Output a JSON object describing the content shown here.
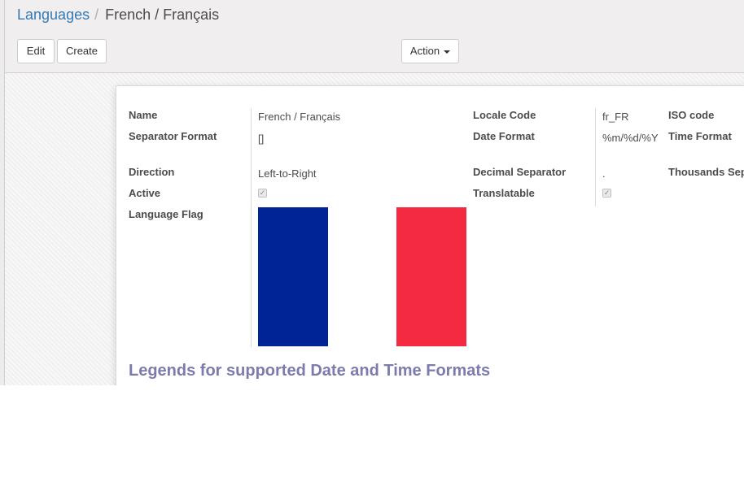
{
  "breadcrumb": {
    "parent": "Languages",
    "separator": "/",
    "current": "French / Français"
  },
  "buttons": {
    "edit": "Edit",
    "create": "Create",
    "action": "Action"
  },
  "form": {
    "name_label": "Name",
    "name_value": "French / Français",
    "separator_format_label": "Separator Format",
    "separator_format_value": "[]",
    "direction_label": "Direction",
    "direction_value": "Left-to-Right",
    "active_label": "Active",
    "active_checked": true,
    "language_flag_label": "Language Flag",
    "locale_code_label": "Locale Code",
    "locale_code_value": "fr_FR",
    "date_format_label": "Date Format",
    "date_format_value": "%m/%d/%Y",
    "decimal_separator_label": "Decimal Separator",
    "decimal_separator_value": ".",
    "translatable_label": "Translatable",
    "translatable_checked": true,
    "iso_code_label": "ISO code",
    "time_format_label": "Time Format",
    "thousands_separator_label": "Thousands Separator"
  },
  "flag_colors": {
    "blue": "#002395",
    "white": "#ffffff",
    "red": "#f42a41"
  },
  "legend_title": "Legends for supported Date and Time Formats",
  "colors": {
    "link": "#337ab7",
    "legend": "#7c7bad"
  }
}
